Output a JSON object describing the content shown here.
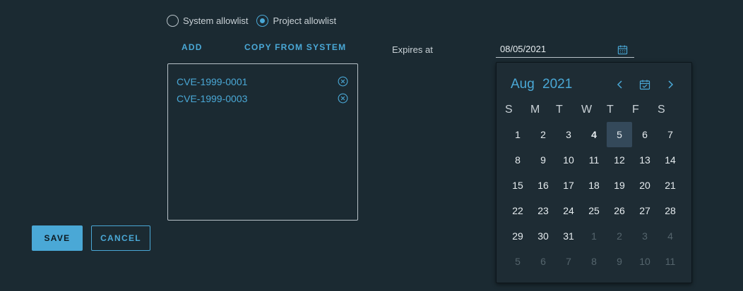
{
  "allowlist_mode": {
    "options": [
      {
        "label": "System allowlist",
        "checked": false
      },
      {
        "label": "Project allowlist",
        "checked": true
      }
    ]
  },
  "actions": {
    "add_label": "ADD",
    "copy_label": "COPY FROM SYSTEM"
  },
  "cve_list": {
    "items": [
      "CVE-1999-0001",
      "CVE-1999-0003"
    ]
  },
  "expires": {
    "label": "Expires at",
    "value": "08/05/2021"
  },
  "calendar": {
    "month": "Aug",
    "year": "2021",
    "weekdays": [
      "S",
      "M",
      "T",
      "W",
      "T",
      "F",
      "S"
    ],
    "weeks": [
      [
        {
          "d": "1"
        },
        {
          "d": "2"
        },
        {
          "d": "3"
        },
        {
          "d": "4",
          "today": true
        },
        {
          "d": "5",
          "selected": true
        },
        {
          "d": "6"
        },
        {
          "d": "7"
        }
      ],
      [
        {
          "d": "8"
        },
        {
          "d": "9"
        },
        {
          "d": "10"
        },
        {
          "d": "11"
        },
        {
          "d": "12"
        },
        {
          "d": "13"
        },
        {
          "d": "14"
        }
      ],
      [
        {
          "d": "15"
        },
        {
          "d": "16"
        },
        {
          "d": "17"
        },
        {
          "d": "18"
        },
        {
          "d": "19"
        },
        {
          "d": "20"
        },
        {
          "d": "21"
        }
      ],
      [
        {
          "d": "22"
        },
        {
          "d": "23"
        },
        {
          "d": "24"
        },
        {
          "d": "25"
        },
        {
          "d": "26"
        },
        {
          "d": "27"
        },
        {
          "d": "28"
        }
      ],
      [
        {
          "d": "29"
        },
        {
          "d": "30"
        },
        {
          "d": "31"
        },
        {
          "d": "1",
          "muted": true
        },
        {
          "d": "2",
          "muted": true
        },
        {
          "d": "3",
          "muted": true
        },
        {
          "d": "4",
          "muted": true
        }
      ],
      [
        {
          "d": "5",
          "muted": true
        },
        {
          "d": "6",
          "muted": true
        },
        {
          "d": "7",
          "muted": true
        },
        {
          "d": "8",
          "muted": true
        },
        {
          "d": "9",
          "muted": true
        },
        {
          "d": "10",
          "muted": true
        },
        {
          "d": "11",
          "muted": true
        }
      ]
    ]
  },
  "footer": {
    "save_label": "SAVE",
    "cancel_label": "CANCEL"
  },
  "icons": {
    "remove": "close-circle-icon",
    "calendar": "calendar-icon",
    "prev": "chevron-left-icon",
    "today": "calendar-check-icon",
    "next": "chevron-right-icon"
  },
  "colors": {
    "background": "#1b2a32",
    "accent": "#4aa8d6",
    "popup": "#1e2c34",
    "selected_day": "#34495a"
  }
}
